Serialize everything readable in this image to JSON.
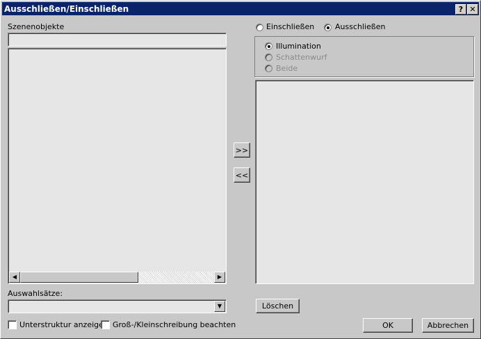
{
  "window": {
    "title": "Ausschließen/Einschließen",
    "help_label": "?",
    "close_label": "✕"
  },
  "scene": {
    "label": "Szenenobjekte",
    "filter_value": "",
    "items": []
  },
  "transfer": {
    "add_label": ">>",
    "remove_label": "<<"
  },
  "mode": {
    "include_label": "Einschließen",
    "exclude_label": "Ausschließen",
    "selected": "Ausschließen"
  },
  "target": {
    "illumination_label": "Illumination",
    "shadow_label": "Schattenwurf",
    "both_label": "Beide",
    "selected": "Illumination"
  },
  "selection_sets": {
    "label": "Auswahlsätze:",
    "value": ""
  },
  "options": {
    "show_substructure_label": "Unterstruktur anzeigen",
    "case_sensitive_label": "Groß-/Kleinschreibung beachten"
  },
  "buttons": {
    "clear_label": "Löschen",
    "ok_label": "OK",
    "cancel_label": "Abbrechen"
  }
}
